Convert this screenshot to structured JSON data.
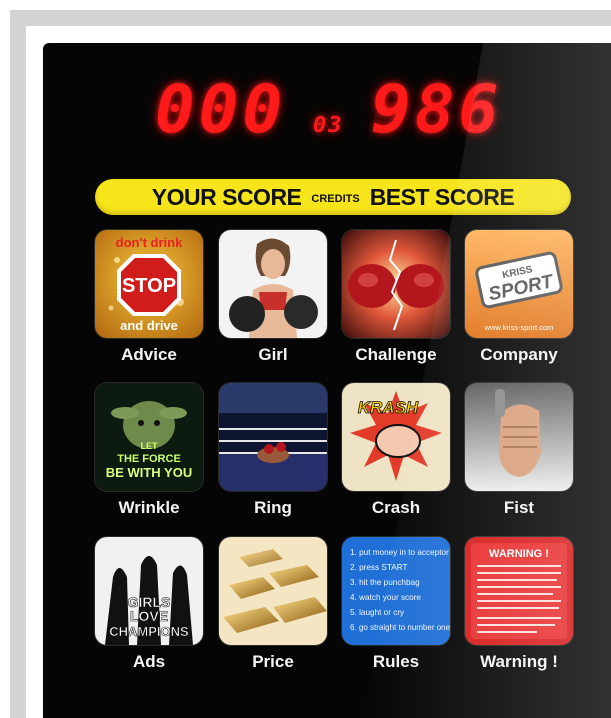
{
  "display": {
    "your_score": "000",
    "credits": "03",
    "best_score": "986"
  },
  "banner": {
    "your_score_label": "YOUR SCORE",
    "credits_label": "CREDITS",
    "best_score_label": "BEST SCORE"
  },
  "tiles": [
    {
      "label": "Advice",
      "icon_text_top": "don't drink",
      "icon_text_sign": "STOP",
      "icon_text_bottom": "and drive"
    },
    {
      "label": "Girl"
    },
    {
      "label": "Challenge"
    },
    {
      "label": "Company",
      "icon_text_1": "KRISS",
      "icon_text_2": "SPORT",
      "icon_text_url": "www.kriss-sport.com"
    },
    {
      "label": "Wrinkle",
      "icon_text_1": "LET",
      "icon_text_2": "THE FORCE",
      "icon_text_3": "BE WITH YOU"
    },
    {
      "label": "Ring"
    },
    {
      "label": "Crash",
      "icon_text_1": "KRASH"
    },
    {
      "label": "Fist"
    },
    {
      "label": "Ads",
      "icon_text_1": "GIRLS",
      "icon_text_2": "LOVE",
      "icon_text_3": "CHAMPIONS"
    },
    {
      "label": "Price"
    },
    {
      "label": "Rules",
      "rules": [
        "1. put money in to acceptor",
        "2. press START",
        "3. hit the punchbag",
        "4. watch your score",
        "5. laught or cry",
        "6. go straight to number one"
      ]
    },
    {
      "label": "Warning !",
      "icon_text_1": "WARNING !"
    }
  ],
  "colors": {
    "panel": "#050505",
    "led": "#ff1a1a",
    "banner": "#f5e51a",
    "rules_bg": "#1f6fd6",
    "warning_red": "#d81c1c",
    "company_orange": "#f28a24"
  }
}
